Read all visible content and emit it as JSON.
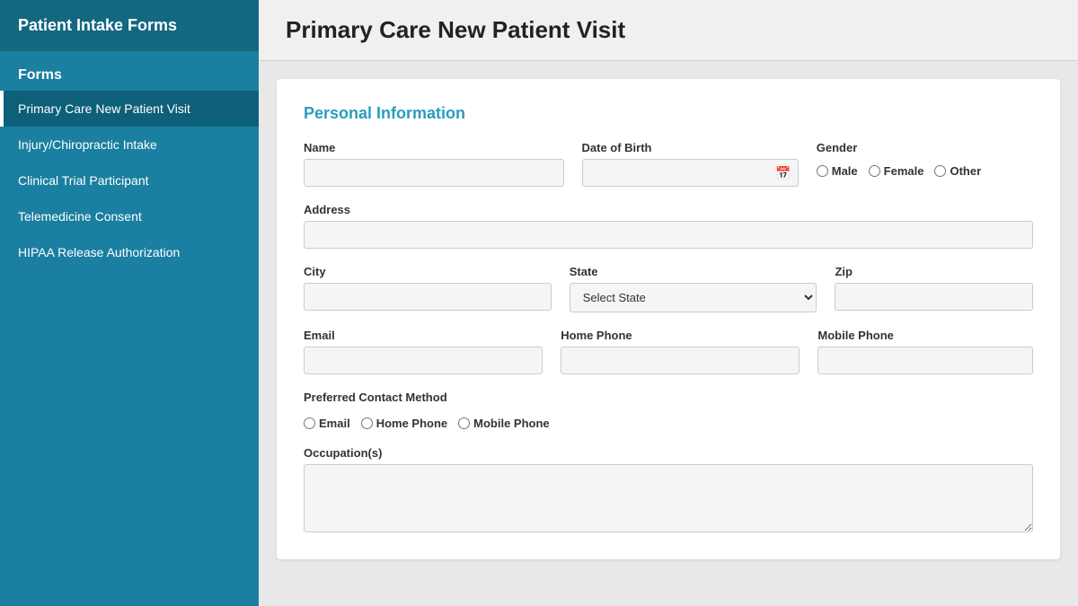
{
  "sidebar": {
    "title": "Patient Intake Forms",
    "forms_label": "Forms",
    "items": [
      {
        "id": "primary-care",
        "label": "Primary Care New Patient Visit",
        "active": true
      },
      {
        "id": "injury-chiropractic",
        "label": "Injury/Chiropractic Intake",
        "active": false
      },
      {
        "id": "clinical-trial",
        "label": "Clinical Trial Participant",
        "active": false
      },
      {
        "id": "telemedicine",
        "label": "Telemedicine Consent",
        "active": false
      },
      {
        "id": "hipaa",
        "label": "HIPAA Release Authorization",
        "active": false
      }
    ]
  },
  "main": {
    "title": "Primary Care New Patient Visit",
    "section_title": "Personal Information",
    "fields": {
      "name_label": "Name",
      "dob_label": "Date of Birth",
      "gender_label": "Gender",
      "gender_options": [
        "Male",
        "Female",
        "Other"
      ],
      "address_label": "Address",
      "city_label": "City",
      "state_label": "State",
      "state_placeholder": "Select State",
      "zip_label": "Zip",
      "email_label": "Email",
      "homephone_label": "Home Phone",
      "mobilephone_label": "Mobile Phone",
      "preferred_contact_label": "Preferred Contact Method",
      "preferred_contact_options": [
        "Email",
        "Home Phone",
        "Mobile Phone"
      ],
      "occupations_label": "Occupation(s)"
    }
  }
}
